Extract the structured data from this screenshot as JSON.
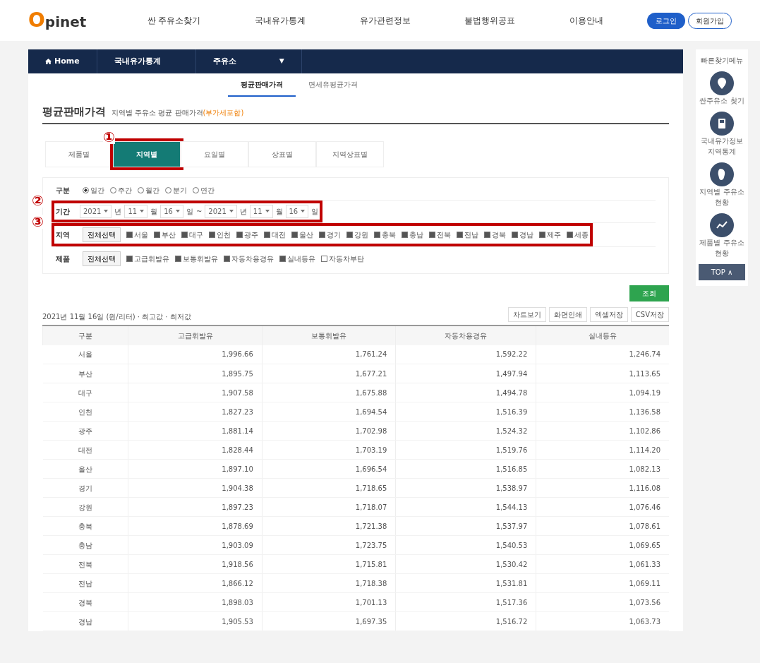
{
  "header": {
    "logo_initial": "O",
    "logo_rest": "pinet",
    "menu": [
      "싼 주유소찾기",
      "국내유가통계",
      "유가관련정보",
      "불법행위공표",
      "이용안내"
    ],
    "login": "로그인",
    "signup": "회원가입"
  },
  "breadcrumb": {
    "home": "Home",
    "items": [
      "국내유가통계",
      "주유소"
    ],
    "toggle": "▼"
  },
  "subtabs": [
    {
      "label": "평균판매가격",
      "selected": true
    },
    {
      "label": "면세유평균가격",
      "selected": false
    }
  ],
  "heading": {
    "title": "평균판매가격",
    "subtitle": "지역별 주유소 평균 판매가격",
    "note": "(부가세포함)"
  },
  "tabs": [
    {
      "label": "제품별",
      "selected": false
    },
    {
      "label": "지역별",
      "selected": true,
      "marker": "①"
    },
    {
      "label": "요일별",
      "selected": false
    },
    {
      "label": "상표별",
      "selected": false
    },
    {
      "label": "지역상표별",
      "selected": false
    }
  ],
  "filters": {
    "type_label": "구분",
    "types": [
      {
        "label": "일간",
        "selected": true
      },
      {
        "label": "주간",
        "selected": false
      },
      {
        "label": "월간",
        "selected": false
      },
      {
        "label": "분기",
        "selected": false
      },
      {
        "label": "연간",
        "selected": false
      }
    ],
    "period_label": "기간",
    "period_marker": "②",
    "period": [
      {
        "value": "2021",
        "unit": "년"
      },
      {
        "value": "11",
        "unit": "월"
      },
      {
        "value": "16",
        "unit": "일"
      },
      {
        "sep": "~"
      },
      {
        "value": "2021",
        "unit": "년"
      },
      {
        "value": "11",
        "unit": "월"
      },
      {
        "value": "16",
        "unit": "일"
      }
    ],
    "region_label": "지역",
    "region_marker": "③",
    "region_all": "전체선택",
    "regions": [
      {
        "label": "서울",
        "checked": true
      },
      {
        "label": "부산",
        "checked": true
      },
      {
        "label": "대구",
        "checked": true
      },
      {
        "label": "인천",
        "checked": true
      },
      {
        "label": "광주",
        "checked": true
      },
      {
        "label": "대전",
        "checked": true
      },
      {
        "label": "울산",
        "checked": true
      },
      {
        "label": "경기",
        "checked": true
      },
      {
        "label": "강원",
        "checked": true
      },
      {
        "label": "충북",
        "checked": true
      },
      {
        "label": "충남",
        "checked": true
      },
      {
        "label": "전북",
        "checked": true
      },
      {
        "label": "전남",
        "checked": true
      },
      {
        "label": "경북",
        "checked": true
      },
      {
        "label": "경남",
        "checked": true
      },
      {
        "label": "제주",
        "checked": true
      },
      {
        "label": "세종",
        "checked": true
      }
    ],
    "product_label": "제품",
    "product_all": "전체선택",
    "products": [
      {
        "label": "고급휘발유",
        "checked": true
      },
      {
        "label": "보통휘발유",
        "checked": true
      },
      {
        "label": "자동차용경유",
        "checked": true
      },
      {
        "label": "실내등유",
        "checked": true
      },
      {
        "label": "자동차부탄",
        "checked": false
      }
    ]
  },
  "search_button": "조회",
  "result_info": "2021년 11월 16일 (원/리터) · 최고값 · 최저값",
  "actions": [
    "차트보기",
    "화면인쇄",
    "엑셀저장",
    "CSV저장"
  ],
  "table": {
    "columns": [
      "구분",
      "고급휘발유",
      "보통휘발유",
      "자동차용경유",
      "실내등유"
    ],
    "rows": [
      [
        "서울",
        "1,996.66",
        "1,761.24",
        "1,592.22",
        "1,246.74"
      ],
      [
        "부산",
        "1,895.75",
        "1,677.21",
        "1,497.94",
        "1,113.65"
      ],
      [
        "대구",
        "1,907.58",
        "1,675.88",
        "1,494.78",
        "1,094.19"
      ],
      [
        "인천",
        "1,827.23",
        "1,694.54",
        "1,516.39",
        "1,136.58"
      ],
      [
        "광주",
        "1,881.14",
        "1,702.98",
        "1,524.32",
        "1,102.86"
      ],
      [
        "대전",
        "1,828.44",
        "1,703.19",
        "1,519.76",
        "1,114.20"
      ],
      [
        "울산",
        "1,897.10",
        "1,696.54",
        "1,516.85",
        "1,082.13"
      ],
      [
        "경기",
        "1,904.38",
        "1,718.65",
        "1,538.97",
        "1,116.08"
      ],
      [
        "강원",
        "1,897.23",
        "1,718.07",
        "1,544.13",
        "1,076.46"
      ],
      [
        "충북",
        "1,878.69",
        "1,721.38",
        "1,537.97",
        "1,078.61"
      ],
      [
        "충남",
        "1,903.09",
        "1,723.75",
        "1,540.53",
        "1,069.65"
      ],
      [
        "전북",
        "1,918.56",
        "1,715.81",
        "1,530.42",
        "1,061.33"
      ],
      [
        "전남",
        "1,866.12",
        "1,718.38",
        "1,531.81",
        "1,069.11"
      ],
      [
        "경북",
        "1,898.03",
        "1,701.13",
        "1,517.36",
        "1,073.56"
      ],
      [
        "경남",
        "1,905.53",
        "1,697.35",
        "1,516.72",
        "1,063.73"
      ]
    ]
  },
  "quick_menu": {
    "title": "빠른찾기메뉴",
    "items": [
      {
        "kind": "pin",
        "label": "싼주유소 찾기"
      },
      {
        "kind": "pump",
        "label": "국내유가정보 지역통계"
      },
      {
        "kind": "map",
        "label": "지역별 주유소현황"
      },
      {
        "kind": "chart",
        "label": "제품별 주유소현황"
      }
    ],
    "top": "TOP ∧"
  }
}
